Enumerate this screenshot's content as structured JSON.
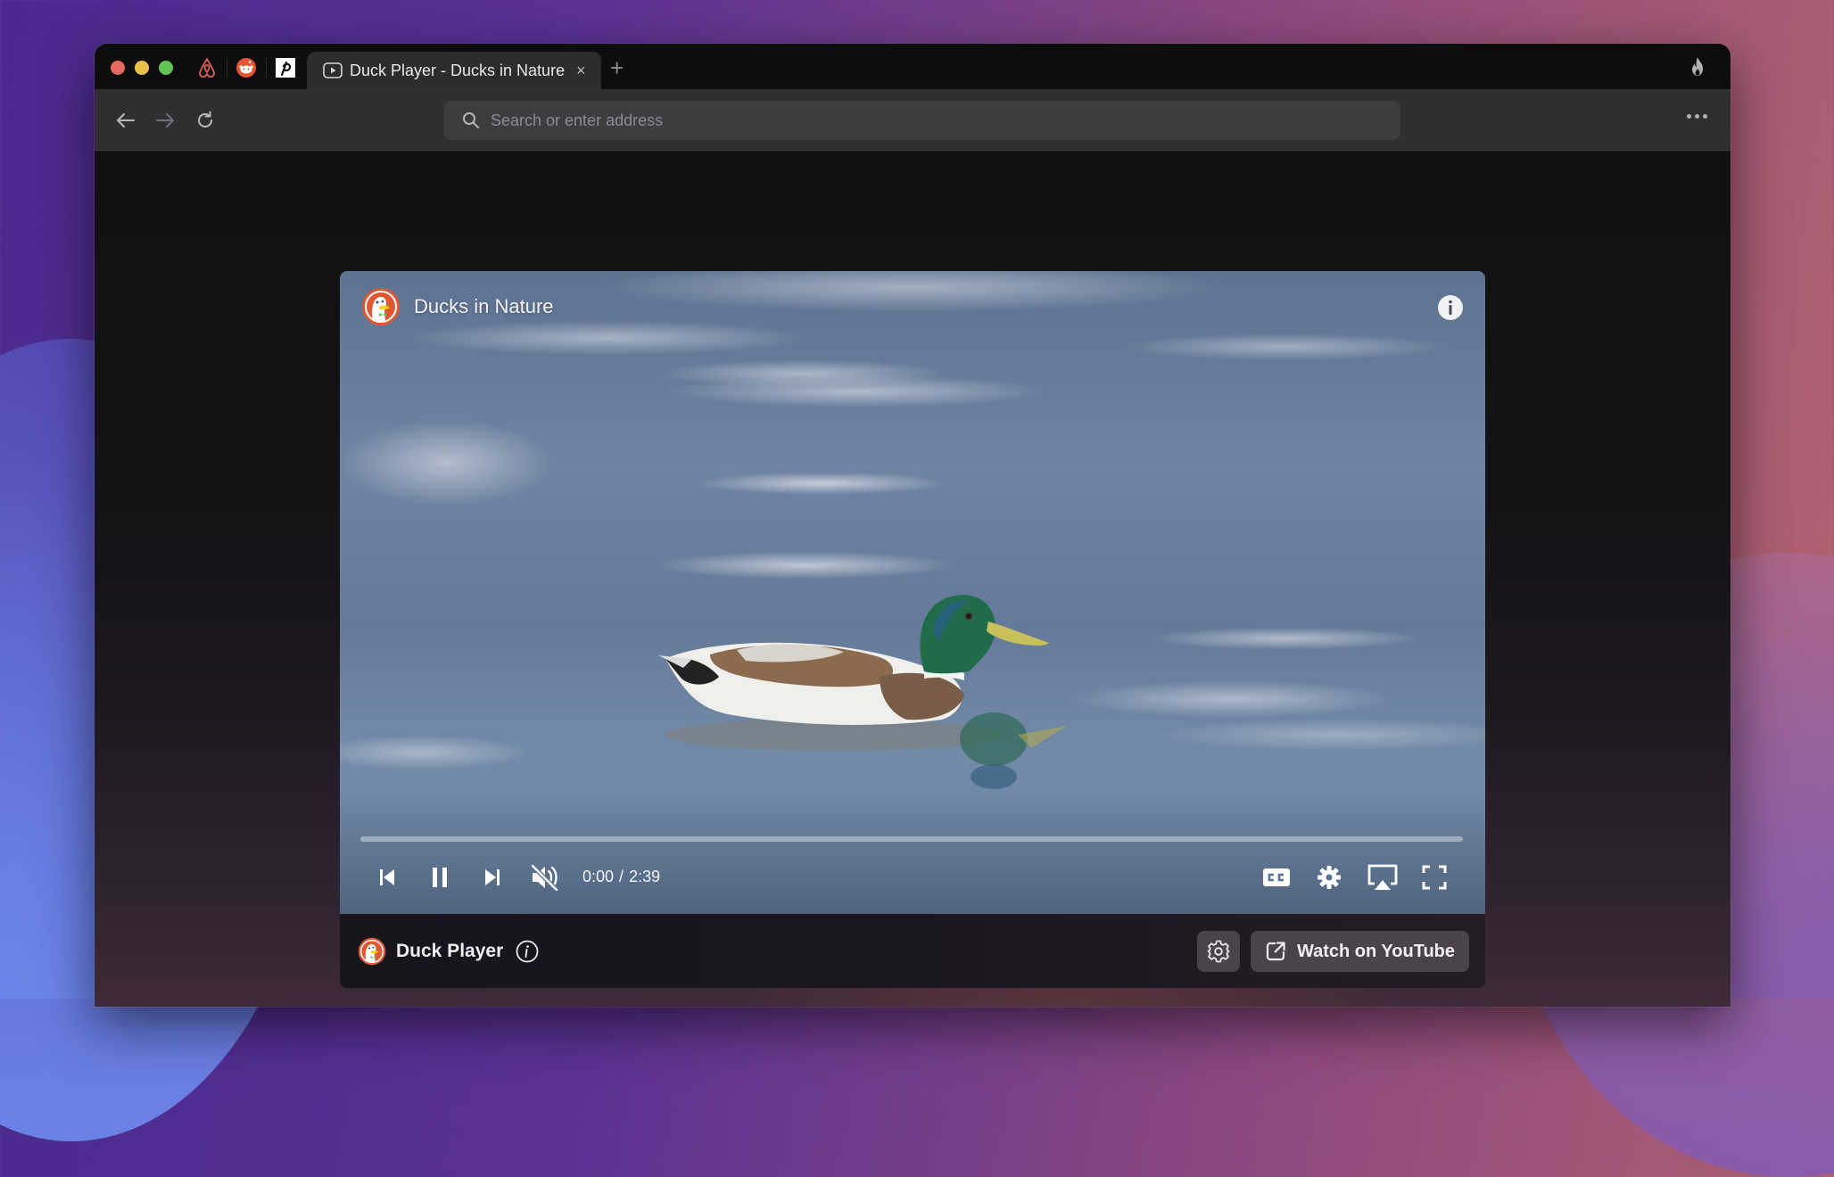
{
  "window": {
    "traffic_lights": [
      "close",
      "minimize",
      "maximize"
    ],
    "colors": {
      "close": "#e5695f",
      "minimize": "#e9bf4b",
      "maximize": "#62c454"
    }
  },
  "tabs": {
    "pinned": [
      {
        "name": "airbnb",
        "icon": "airbnb-icon"
      },
      {
        "name": "reddit",
        "icon": "reddit-icon"
      },
      {
        "name": "peloton",
        "icon": "peloton-icon"
      }
    ],
    "active": {
      "title": "Duck Player - Ducks in Nature",
      "icon": "play-icon",
      "close_glyph": "×"
    },
    "new_tab_glyph": "+",
    "fire_button": "fire-icon"
  },
  "toolbar": {
    "back": "back-arrow-icon",
    "forward": "forward-arrow-icon",
    "reload": "reload-icon",
    "address": {
      "value": "",
      "placeholder": "Search or enter address"
    },
    "more": "more-menu-icon"
  },
  "player": {
    "video_title": "Ducks in Nature",
    "current_time": "0:00",
    "time_separator": "/",
    "duration": "2:39",
    "progress_fraction": 0.0,
    "muted": true,
    "playing": true,
    "controls": [
      "previous",
      "pause",
      "next",
      "mute",
      "captions",
      "settings",
      "airplay",
      "fullscreen"
    ]
  },
  "footer": {
    "brand": "Duck Player",
    "watch_on_youtube": "Watch on YouTube"
  },
  "colors": {
    "brand_orange": "#de5833",
    "button_bg": "#4a4349"
  }
}
